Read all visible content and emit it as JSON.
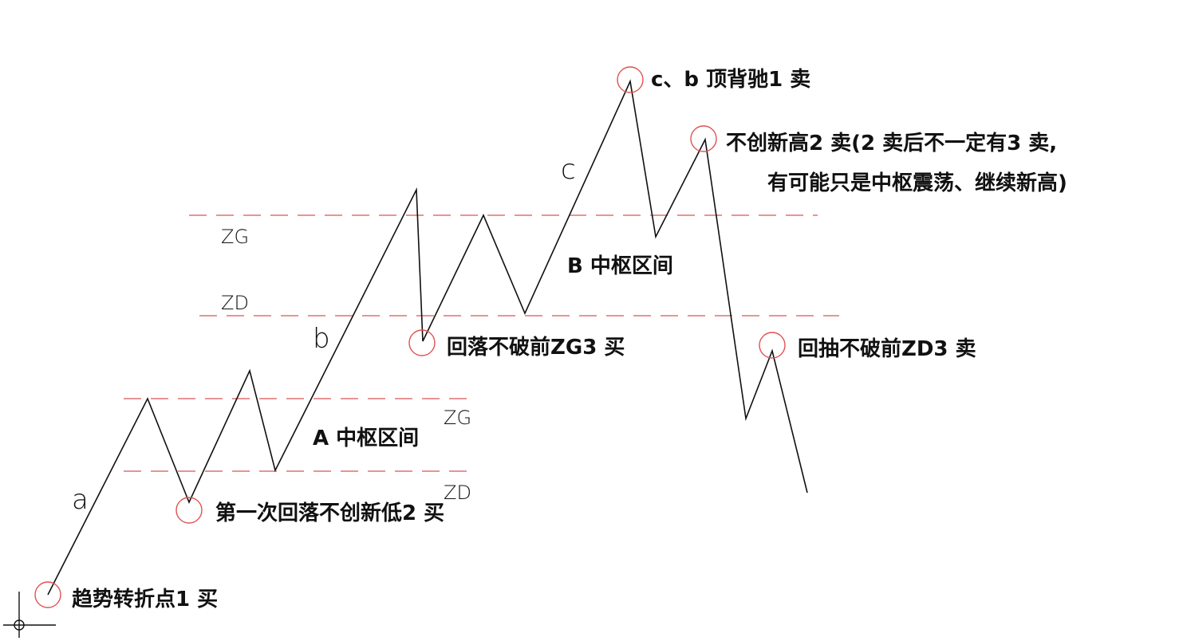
{
  "colors": {
    "background": "#ffffff",
    "price_line": "#111111",
    "zone_dash": "#e07070",
    "marker_circle": "#e05050",
    "text": "#111111"
  },
  "zones": {
    "a_zg_label": "ZG",
    "a_zd_label": "ZD",
    "a_name": "A 中枢区间",
    "b_zg_label": "ZG",
    "b_zd_label": "ZD",
    "b_name": "B 中枢区间"
  },
  "segments": {
    "a": "a",
    "b": "b",
    "c": "c"
  },
  "markers": {
    "buy1": "趋势转折点1 买",
    "buy2": "第一次回落不创新低2 买",
    "buy3": "回落不破前ZG3 买",
    "sell1": "c、b 顶背驰1 卖",
    "sell2_line1": "不创新高2 卖(2 卖后不一定有3 卖,",
    "sell2_line2": "有可能只是中枢震荡、继续新高)",
    "sell3": "回抽不破前ZD3 卖"
  }
}
